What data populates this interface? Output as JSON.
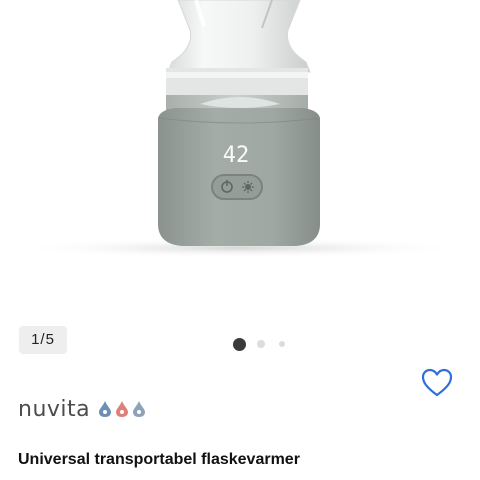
{
  "gallery": {
    "counter": "1/5",
    "slide_count": 3,
    "active_slide": 1,
    "display_digits": "42",
    "image_alt": "Universal transportabel flaskevarmer"
  },
  "brand": {
    "name": "nuvita"
  },
  "product": {
    "title": "Universal transportabel flaskevarmer"
  },
  "icons": {
    "wishlist": "heart-outline-icon",
    "power": "power-icon",
    "temperature": "sun-icon"
  },
  "colors": {
    "accent": "#2f6fd6",
    "warmer_body": "#9aa39e",
    "text": "#111111"
  }
}
